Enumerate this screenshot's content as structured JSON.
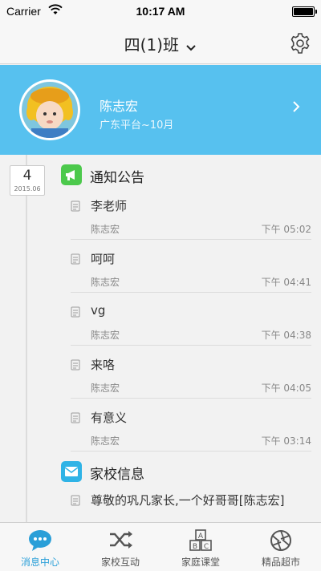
{
  "status_bar": {
    "carrier": "Carrier",
    "time": "10:17 AM"
  },
  "header": {
    "title": "四(1)班"
  },
  "profile": {
    "name": "陈志宏",
    "subtitle": "广东平台~10月"
  },
  "date_badge": {
    "day": "4",
    "year_month": "2015.06"
  },
  "sections": [
    {
      "title": "通知公告",
      "icon": "megaphone-icon",
      "color": "#4cc94c",
      "items": [
        {
          "title": "李老师",
          "sender": "陈志宏",
          "time": "下午 05:02"
        },
        {
          "title": "呵呵",
          "sender": "陈志宏",
          "time": "下午 04:41"
        },
        {
          "title": "vg",
          "sender": "陈志宏",
          "time": "下午 04:38"
        },
        {
          "title": "来咯",
          "sender": "陈志宏",
          "time": "下午 04:05"
        },
        {
          "title": "有意义",
          "sender": "陈志宏",
          "time": "下午 03:14"
        }
      ]
    },
    {
      "title": "家校信息",
      "icon": "mail-icon",
      "color": "#2fb3e6",
      "items": [
        {
          "title": "尊敬的巩凡家长,一个好哥哥[陈志宏]"
        }
      ]
    }
  ],
  "tabs": [
    {
      "label": "消息中心",
      "icon": "chat-bubble-icon",
      "active": true
    },
    {
      "label": "家校互动",
      "icon": "shuffle-icon",
      "active": false
    },
    {
      "label": "家庭课堂",
      "icon": "abc-blocks-icon",
      "active": false
    },
    {
      "label": "精品超市",
      "icon": "aperture-icon",
      "active": false
    }
  ],
  "colors": {
    "accent": "#2a9fd8",
    "banner": "#57c1ef"
  }
}
